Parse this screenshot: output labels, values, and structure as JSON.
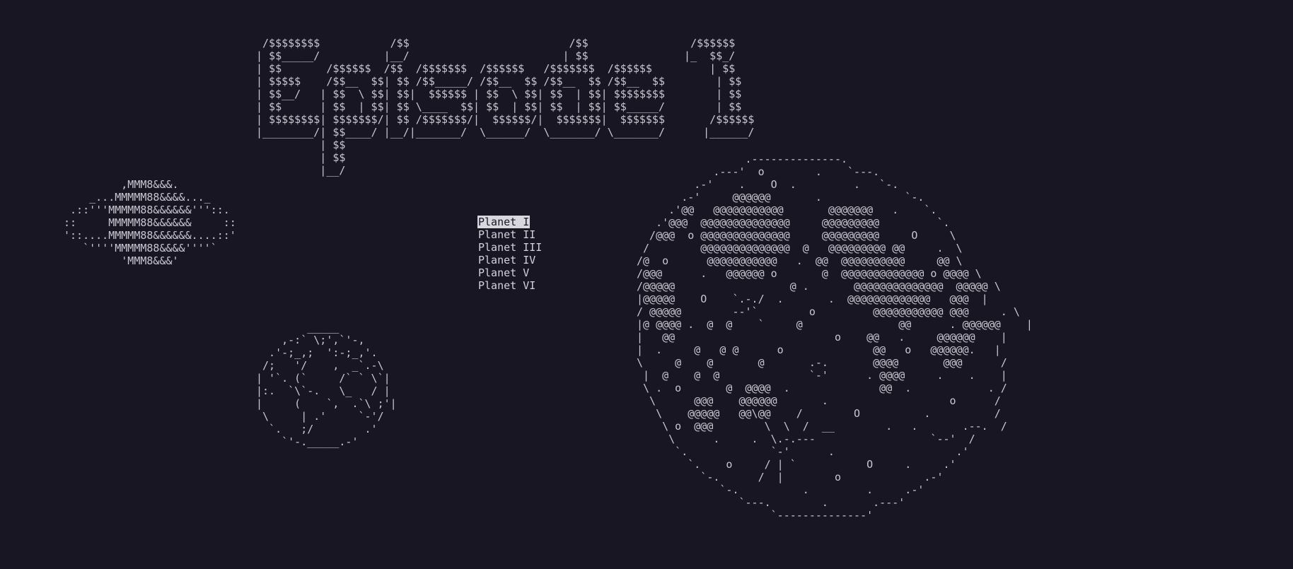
{
  "title_art": " /$$$$$$$$           /$$                         /$$                /$$$$$$\n| $$_____/          |__/                        | $$               |_  $$_/\n| $$       /$$$$$$  /$$  /$$$$$$$  /$$$$$$   /$$$$$$$  /$$$$$$         | $$  \n| $$$$$    /$$__  $$| $$ /$$_____/ /$$__  $$ /$$__  $$ /$$__  $$        | $$  \n| $$__/   | $$  \\ $$| $$|  $$$$$$ | $$  \\ $$| $$  | $$| $$$$$$$$        | $$  \n| $$      | $$  | $$| $$ \\____  $$| $$  | $$| $$  | $$| $$_____/        | $$  \n| $$$$$$$$| $$$$$$$/| $$ /$$$$$$$/|  $$$$$$/|  $$$$$$$|  $$$$$$$       /$$$$$$\n|________/| $$____/ |__/|_______/  \\______/  \\_______/ \\_______/      |______/\n          | $$\n          | $$\n          |__/",
  "ringed_planet_art": "         ,MMM8&&&.\n    _...MMMMM88&&&&..._\n .::'''MMMMM88&&&&&&'''::.\n::     MMMMM88&&&&&&     ::\n'::....MMMMM88&&&&&&....::'\n   `''''MMMMM88&&&&''''`\n         'MMM8&&&'",
  "small_planet_art": "        _____\n    ,-:` \\;',`'-, \n  .'-;_,;  ':-;_,'.\n /;   '/    ,  _`.-\\\n| '`. (`     /` ` \\`|\n|:.  `\\`-.   \\_   / |\n|     (    `,  .`\\ ;'|\n \\     | .'     `-'/\n  `.   ;/        .'\n    `'-._____.-'",
  "big_planet_art": "                 .--------------.\n            .---'  o        .    `---.\n         .-'    .    O  .         .   `-.\n       .-'     @@@@@@       .             `-.\n     .'@@   @@@@@@@@@@@       @@@@@@@   .    `.\n   .'@@@  @@@@@@@@@@@@@@     @@@@@@@@@         `.\n  /@@@  o @@@@@@@@@@@@@@     @@@@@@@@@     O     \\\n /        @@@@@@@@@@@@@@  @   @@@@@@@@@ @@     .  \\\n/@  o      @@@@@@@@@@@   .  @@  @@@@@@@@@@     @@ \\\n/@@@      .   @@@@@@ o       @  @@@@@@@@@@@@@ o @@@@ \\\n/@@@@@                  @ .       @@@@@@@@@@@@@@  @@@@@ \\\n|@@@@@    O    `.-./  .       .  @@@@@@@@@@@@@   @@@  |\n/ @@@@@        --'`        o         @@@@@@@@@@@ @@@     . \\\n|@ @@@@ .  @  @    `     @               @@      . @@@@@@    |\n|   @@                         o    @@   .     @@@@@@    |\n|  .     @   @ @      o              @@   o   @@@@@@.   |\n\\     @    @       @       .-.       @@@@       @@@      /\n |  @    @  @              `-'      . @@@@     .    .    |\n \\ .  o       @  @@@@  .              @@  .            . /\n  \\      @@@    @@@@@@       .                   o      /\n   \\    @@@@@   @@\\@@    /        O          .          /\n    \\ o  @@@        \\  \\  /  __        .   .       .--.  /\n     \\      .     .  \\.-.---                  `--'  /\n      `.             `-'      .                   .'\n        `.    o     / | `           O     .     .'\n          `-.      /  |        o             .-'\n             `-.          .         .     .-'\n                `---.        .       .---'\n                     `--------------'",
  "menu": {
    "items": [
      {
        "label": "Planet I",
        "selected": true
      },
      {
        "label": "Planet II",
        "selected": false
      },
      {
        "label": "Planet III",
        "selected": false
      },
      {
        "label": "Planet IV",
        "selected": false
      },
      {
        "label": "Planet V",
        "selected": false
      },
      {
        "label": "Planet VI",
        "selected": false
      }
    ]
  },
  "colors": {
    "background": "#181623",
    "text": "#c9c7cf",
    "selection_background": "#d9d7de",
    "selection_text": "#181623"
  }
}
